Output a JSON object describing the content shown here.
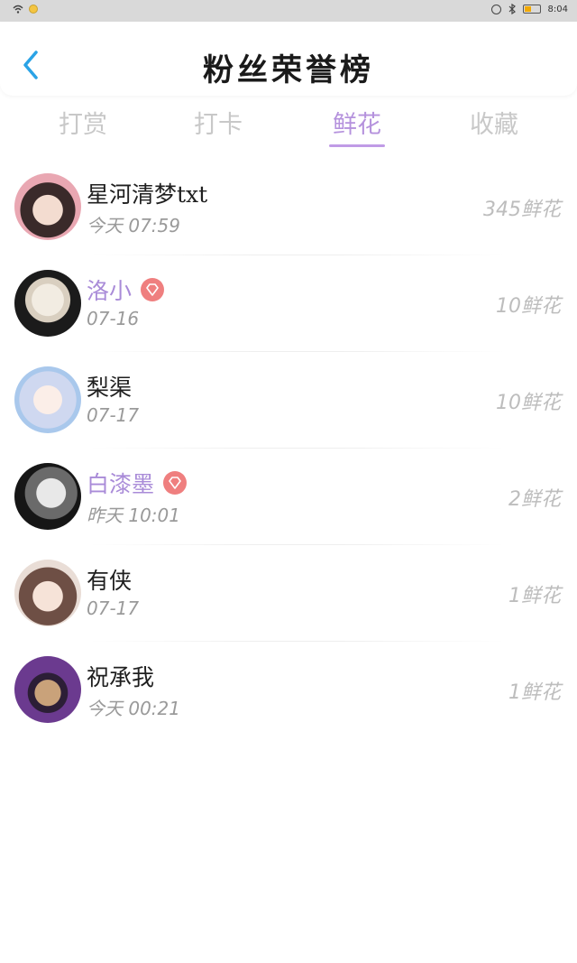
{
  "status_bar": {
    "time": "8:04"
  },
  "header": {
    "title": "粉丝荣誉榜"
  },
  "tabs": [
    {
      "label": "打赏",
      "active": false
    },
    {
      "label": "打卡",
      "active": false
    },
    {
      "label": "鲜花",
      "active": true
    },
    {
      "label": "收藏",
      "active": false
    }
  ],
  "accent_color": "#b592dd",
  "badge_color": "#ef7f7f",
  "fans": [
    {
      "name": "星河清梦txt",
      "time": "今天 07:59",
      "flowers": "345鲜花",
      "vip": false
    },
    {
      "name": "洛小",
      "time": "07-16",
      "flowers": "10鲜花",
      "vip": true
    },
    {
      "name": "梨渠",
      "time": "07-17",
      "flowers": "10鲜花",
      "vip": false
    },
    {
      "name": "白漆墨",
      "time": "昨天 10:01",
      "flowers": "2鲜花",
      "vip": true
    },
    {
      "name": "有侠",
      "time": "07-17",
      "flowers": "1鲜花",
      "vip": false
    },
    {
      "name": "祝承我",
      "time": "今天 00:21",
      "flowers": "1鲜花",
      "vip": false
    }
  ]
}
